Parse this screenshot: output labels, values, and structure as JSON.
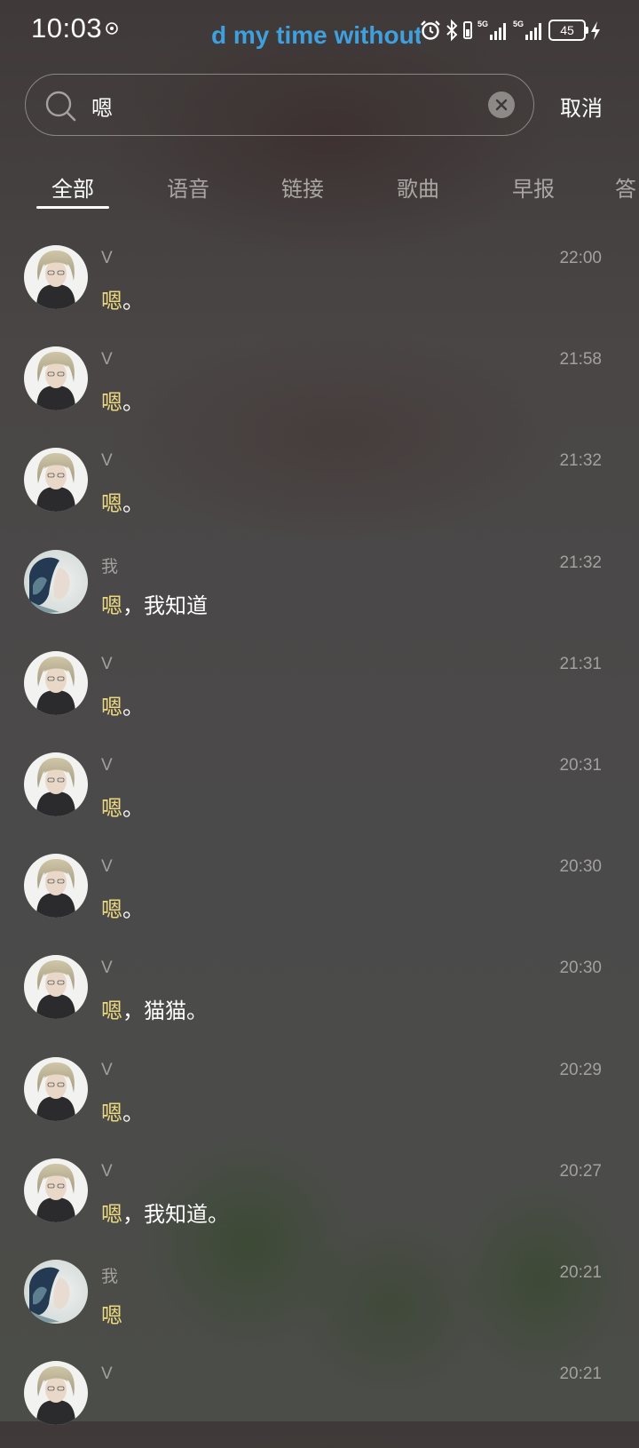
{
  "status_bar": {
    "time": "10:03",
    "lyric": "d my time without",
    "battery": "45",
    "icons": [
      "vpn-icon",
      "alarm-icon",
      "bluetooth-icon",
      "vibrate-icon",
      "signal-5g-icon",
      "signal-5g-icon",
      "battery-icon",
      "charging-icon"
    ],
    "network_labels": [
      "5G",
      "5G"
    ]
  },
  "search": {
    "query": "嗯",
    "cancel_label": "取消"
  },
  "tabs": [
    {
      "label": "全部",
      "active": true
    },
    {
      "label": "语音",
      "active": false
    },
    {
      "label": "链接",
      "active": false
    },
    {
      "label": "歌曲",
      "active": false
    },
    {
      "label": "早报",
      "active": false
    },
    {
      "label": "答",
      "active": false
    }
  ],
  "results": [
    {
      "sender": "V",
      "time": "22:00",
      "highlight": "嗯",
      "rest": "。",
      "avatar": "avatar-v"
    },
    {
      "sender": "V",
      "time": "21:58",
      "highlight": "嗯",
      "rest": "。",
      "avatar": "avatar-v"
    },
    {
      "sender": "V",
      "time": "21:32",
      "highlight": "嗯",
      "rest": "。",
      "avatar": "avatar-v"
    },
    {
      "sender": "我",
      "time": "21:32",
      "highlight": "嗯",
      "rest": "，我知道",
      "avatar": "avatar-me"
    },
    {
      "sender": "V",
      "time": "21:31",
      "highlight": "嗯",
      "rest": "。",
      "avatar": "avatar-v"
    },
    {
      "sender": "V",
      "time": "20:31",
      "highlight": "嗯",
      "rest": "。",
      "avatar": "avatar-v"
    },
    {
      "sender": "V",
      "time": "20:30",
      "highlight": "嗯",
      "rest": "。",
      "avatar": "avatar-v"
    },
    {
      "sender": "V",
      "time": "20:30",
      "highlight": "嗯",
      "rest": "，猫猫。",
      "avatar": "avatar-v"
    },
    {
      "sender": "V",
      "time": "20:29",
      "highlight": "嗯",
      "rest": "。",
      "avatar": "avatar-v"
    },
    {
      "sender": "V",
      "time": "20:27",
      "highlight": "嗯",
      "rest": "，我知道。",
      "avatar": "avatar-v"
    },
    {
      "sender": "我",
      "time": "20:21",
      "highlight": "嗯",
      "rest": "",
      "avatar": "avatar-me"
    },
    {
      "sender": "V",
      "time": "20:21",
      "highlight": "",
      "rest": "",
      "avatar": "avatar-v"
    }
  ],
  "colors": {
    "highlight": "#ecd97f",
    "secondary_text": "#a3a09e",
    "lyric": "#3fa0e0"
  }
}
